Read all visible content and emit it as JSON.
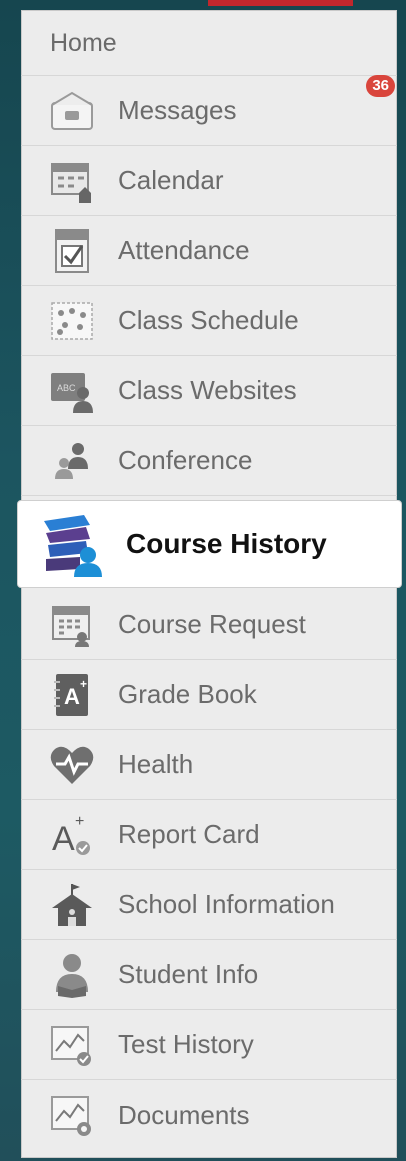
{
  "menu": {
    "home": "Home",
    "items": [
      {
        "label": "Messages",
        "icon": "envelope-icon",
        "badge": "36"
      },
      {
        "label": "Calendar",
        "icon": "calendar-icon"
      },
      {
        "label": "Attendance",
        "icon": "attendance-checkbox-icon"
      },
      {
        "label": "Class Schedule",
        "icon": "schedule-grid-icon"
      },
      {
        "label": "Class Websites",
        "icon": "website-user-icon"
      },
      {
        "label": "Conference",
        "icon": "people-icon"
      },
      {
        "label": "Course History",
        "icon": "books-student-icon",
        "active": true
      },
      {
        "label": "Course Request",
        "icon": "calendar-request-icon"
      },
      {
        "label": "Grade Book",
        "icon": "gradebook-icon"
      },
      {
        "label": "Health",
        "icon": "heart-pulse-icon"
      },
      {
        "label": "Report Card",
        "icon": "report-card-icon"
      },
      {
        "label": "School Information",
        "icon": "school-house-icon"
      },
      {
        "label": "Student Info",
        "icon": "student-reading-icon"
      },
      {
        "label": "Test History",
        "icon": "chart-check-icon"
      },
      {
        "label": "Documents",
        "icon": "documents-chart-icon"
      }
    ]
  },
  "colors": {
    "accent": "#c1272d",
    "badge": "#d9453c",
    "active_bg": "#ffffff"
  }
}
